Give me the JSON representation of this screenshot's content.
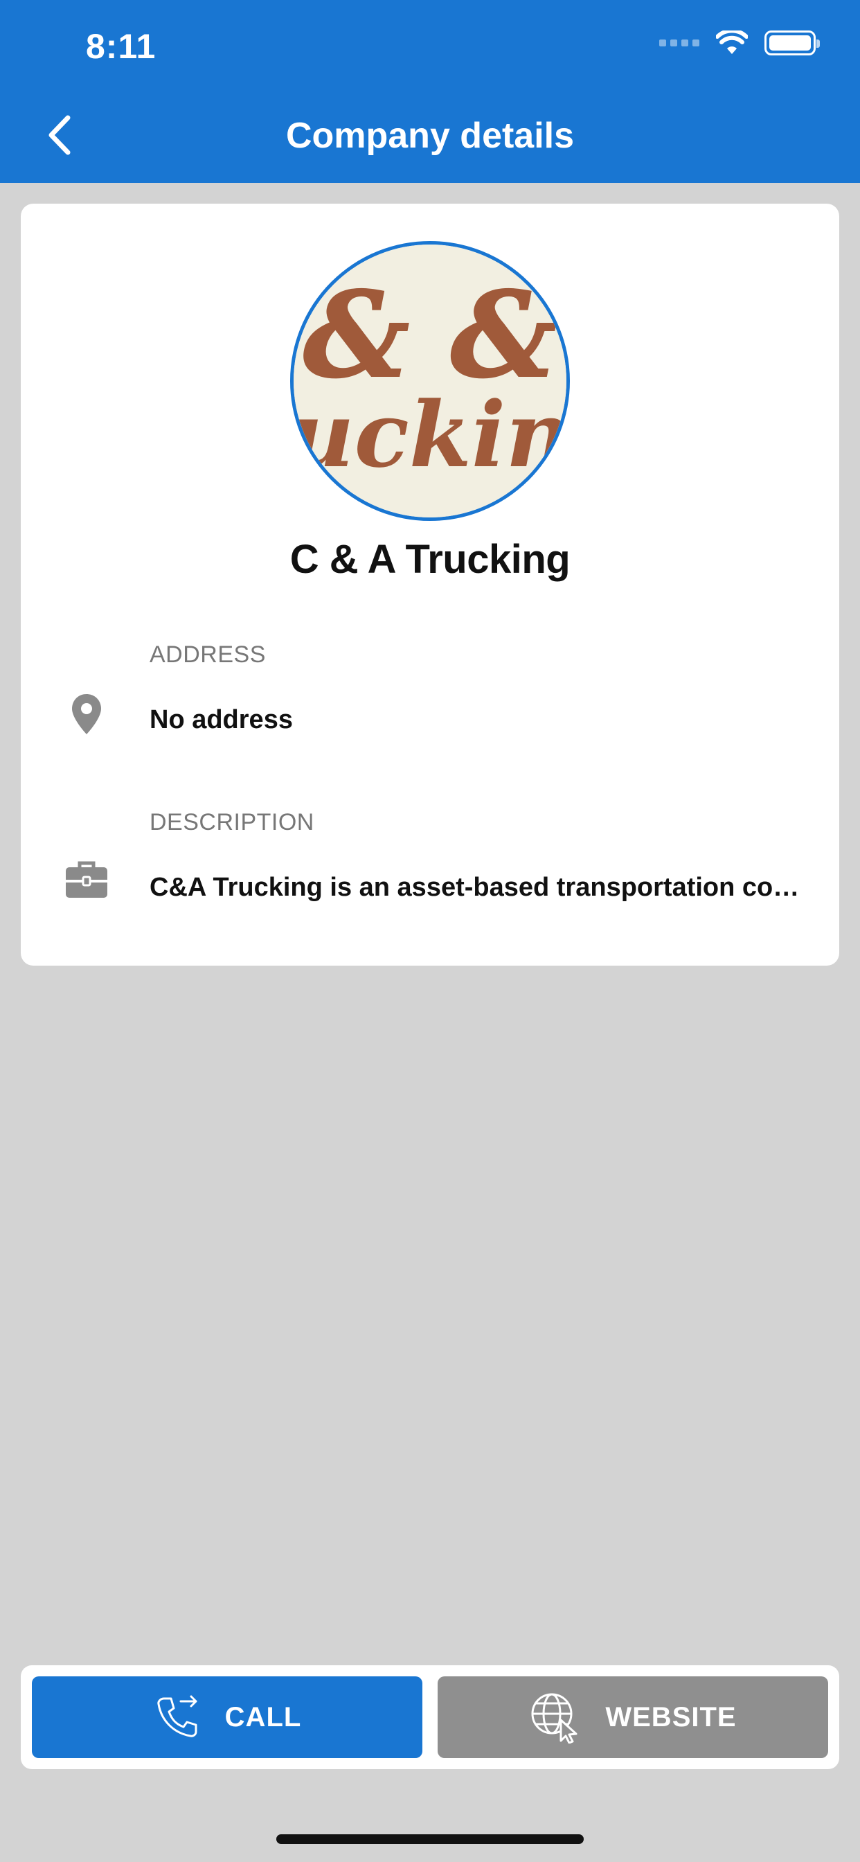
{
  "status_bar": {
    "time": "8:11"
  },
  "header": {
    "title": "Company details"
  },
  "company": {
    "name": "C & A Trucking",
    "logo_text_top": "& &",
    "logo_text_bottom": "uckin"
  },
  "details": {
    "address_label": "ADDRESS",
    "address_value": "No address",
    "description_label": "DESCRIPTION",
    "description_value": "C&A Trucking is an asset-based transportation company that provides reliable services"
  },
  "actions": {
    "call_label": "CALL",
    "website_label": "WEBSITE"
  },
  "colors": {
    "primary": "#1976d2",
    "secondary_button": "#8f8f8f",
    "background": "#d3d3d3",
    "logo_brown": "#a05a3a"
  }
}
